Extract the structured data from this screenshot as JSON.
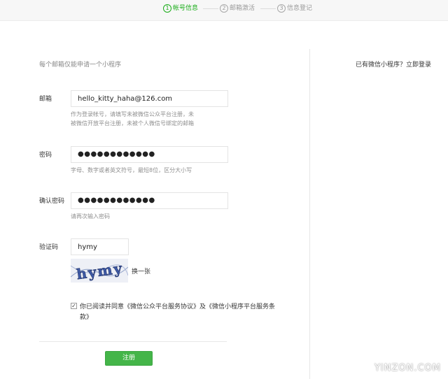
{
  "steps": [
    {
      "num": "1",
      "label": "帐号信息",
      "active": true
    },
    {
      "num": "2",
      "label": "邮箱激活",
      "active": false
    },
    {
      "num": "3",
      "label": "信息登记",
      "active": false
    }
  ],
  "form": {
    "tip": "每个邮箱仅能申请一个小程序",
    "email": {
      "label": "邮箱",
      "value": "hello_kitty_haha@126.com",
      "help_line1": "作为登录帐号，请填写未被微信公众平台注册，未",
      "help_line2": "被微信开放平台注册，未被个人微信号绑定的邮箱"
    },
    "password": {
      "label": "密码",
      "value": "●●●●●●●●●●●●",
      "help": "字母、数字或者英文符号，最短8位，区分大小写"
    },
    "confirm_password": {
      "label": "确认密码",
      "value": "●●●●●●●●●●●●",
      "help": "请再次输入密码"
    },
    "captcha": {
      "label": "验证码",
      "value": "hymy",
      "image_text": "hymy",
      "refresh_label": "换一张"
    },
    "agreement": {
      "checked": true,
      "check_glyph": "✓",
      "prefix": "你已阅读并同意",
      "link1": "《微信公众平台服务协议》",
      "middle": "及",
      "link2": "《微信小程序平台服务条款》"
    },
    "submit_label": "注册"
  },
  "sidebar": {
    "existing_text": "已有微信小程序？",
    "login_link": "立即登录"
  },
  "watermark": "YINZON.COM",
  "colors": {
    "accent": "#1aad19",
    "button": "#44b549"
  }
}
